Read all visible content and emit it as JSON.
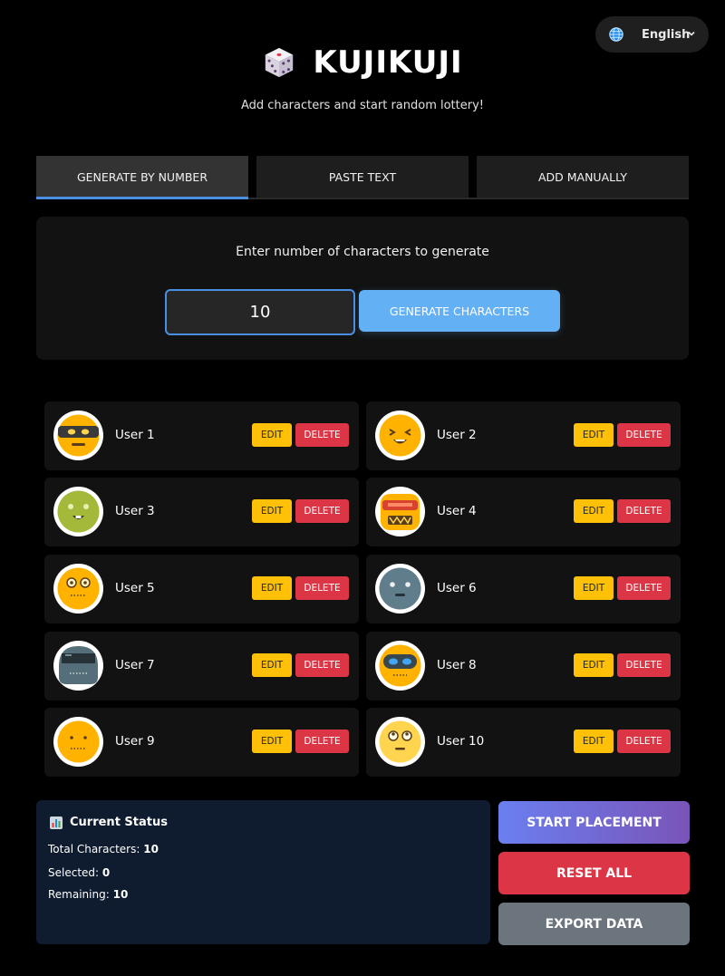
{
  "language": {
    "icon": "globe-icon",
    "label": "English",
    "chevron": "chevron-down-icon"
  },
  "header": {
    "icon": "dice-icon",
    "title": "KUJIKUJI",
    "subtitle": "Add characters and start random lottery!"
  },
  "tabs": [
    {
      "label": "GENERATE BY NUMBER",
      "active": true
    },
    {
      "label": "PASTE TEXT",
      "active": false
    },
    {
      "label": "ADD MANUALLY",
      "active": false
    }
  ],
  "generate": {
    "prompt": "Enter number of characters to generate",
    "count_value": "10",
    "button_label": "GENERATE CHARACTERS"
  },
  "characters": [
    {
      "name": "User 1",
      "avatar": "ninja-face-icon"
    },
    {
      "name": "User 2",
      "avatar": "laughing-face-icon"
    },
    {
      "name": "User 3",
      "avatar": "green-face-icon"
    },
    {
      "name": "User 4",
      "avatar": "robot-face-icon"
    },
    {
      "name": "User 5",
      "avatar": "surprised-face-icon"
    },
    {
      "name": "User 6",
      "avatar": "gray-robot-face-icon"
    },
    {
      "name": "User 7",
      "avatar": "visor-robot-face-icon"
    },
    {
      "name": "User 8",
      "avatar": "goggles-face-icon"
    },
    {
      "name": "User 9",
      "avatar": "plain-face-icon"
    },
    {
      "name": "User 10",
      "avatar": "rolling-eyes-face-icon"
    }
  ],
  "card_buttons": {
    "edit": "EDIT",
    "delete": "DELETE"
  },
  "status": {
    "icon": "bar-chart-icon",
    "title": "Current Status",
    "total_label": "Total Characters:",
    "total_value": "10",
    "selected_label": "Selected:",
    "selected_value": "0",
    "remaining_label": "Remaining:",
    "remaining_value": "10"
  },
  "actions": {
    "start": "START PLACEMENT",
    "reset": "RESET ALL",
    "export": "EXPORT DATA"
  },
  "colors": {
    "accent": "#4a90e2",
    "generate_button": "#64b0f4",
    "edit": "#ffc107",
    "delete": "#dc3545",
    "export": "#6c757d",
    "status_bg": "#0f1b2e"
  }
}
